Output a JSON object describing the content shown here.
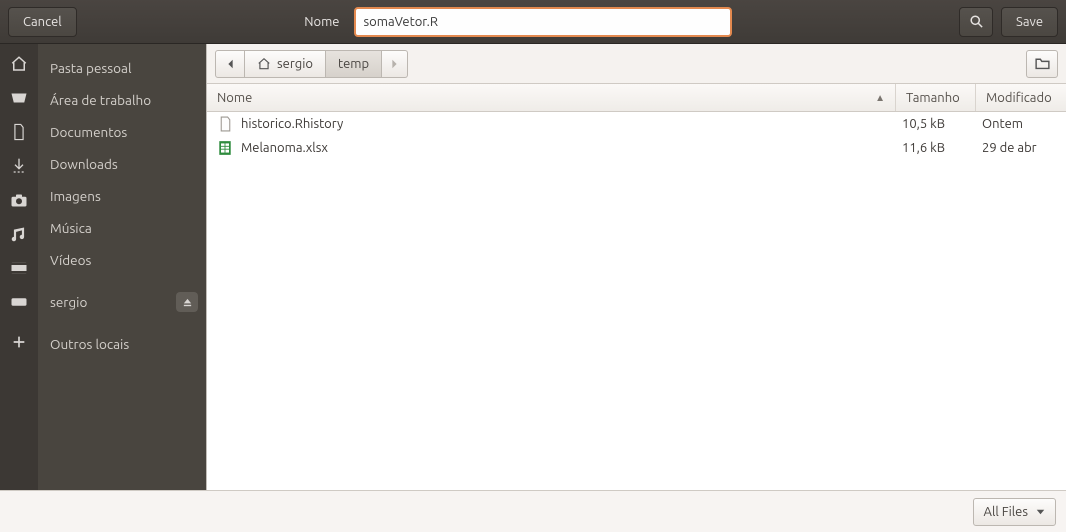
{
  "header": {
    "cancel": "Cancel",
    "name_label": "Nome",
    "filename": "somaVetor.R",
    "save": "Save"
  },
  "sidebar": {
    "items": [
      {
        "label": "Pasta pessoal"
      },
      {
        "label": "Área de trabalho"
      },
      {
        "label": "Documentos"
      },
      {
        "label": "Downloads"
      },
      {
        "label": "Imagens"
      },
      {
        "label": "Música"
      },
      {
        "label": "Vídeos"
      }
    ],
    "mount": {
      "label": "sergio"
    },
    "other": {
      "label": "Outros locais"
    }
  },
  "pathbar": {
    "segments": [
      {
        "label": "sergio"
      },
      {
        "label": "temp"
      }
    ]
  },
  "columns": {
    "name": "Nome",
    "size": "Tamanho",
    "modified": "Modificado"
  },
  "files": [
    {
      "name": "historico.Rhistory",
      "size": "10,5 kB",
      "modified": "Ontem",
      "icon": "text"
    },
    {
      "name": "Melanoma.xlsx",
      "size": "11,6 kB",
      "modified": "29 de abr",
      "icon": "sheet"
    }
  ],
  "footer": {
    "filter": "All Files"
  }
}
